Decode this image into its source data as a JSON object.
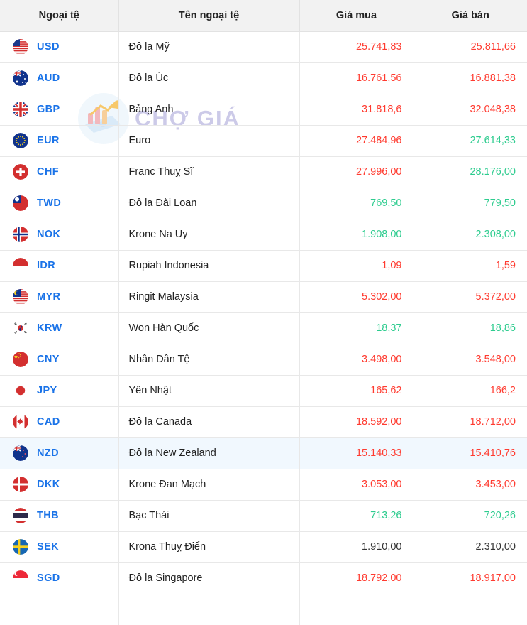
{
  "watermark": {
    "text": "CHỢ GIÁ",
    "logo_icon": "chart-wallet-logo-icon",
    "color": "#b9b6e0"
  },
  "colors": {
    "header_bg": "#f2f2f2",
    "code_blue": "#1a73e8",
    "up_red": "#ff3b30",
    "down_green": "#2ecc8f",
    "flat_black": "#333333",
    "highlight_row_bg": "#f1f8fe"
  },
  "table": {
    "columns": [
      {
        "key": "code",
        "label": "Ngoại tệ",
        "align": "center"
      },
      {
        "key": "name",
        "label": "Tên ngoại tệ",
        "align": "center"
      },
      {
        "key": "buy",
        "label": "Giá mua",
        "align": "center"
      },
      {
        "key": "sell",
        "label": "Giá bán",
        "align": "center"
      }
    ],
    "rows": [
      {
        "code": "USD",
        "flag": "flag-us",
        "name": "Đô la Mỹ",
        "buy": "25.741,83",
        "sell": "25.811,66",
        "buy_trend": "up",
        "sell_trend": "up",
        "highlight": false
      },
      {
        "code": "AUD",
        "flag": "flag-au",
        "name": "Đô la Úc",
        "buy": "16.761,56",
        "sell": "16.881,38",
        "buy_trend": "up",
        "sell_trend": "up",
        "highlight": false
      },
      {
        "code": "GBP",
        "flag": "flag-gb",
        "name": "Bảng Anh",
        "buy": "31.818,6",
        "sell": "32.048,38",
        "buy_trend": "up",
        "sell_trend": "up",
        "highlight": false
      },
      {
        "code": "EUR",
        "flag": "flag-eu",
        "name": "Euro",
        "buy": "27.484,96",
        "sell": "27.614,33",
        "buy_trend": "up",
        "sell_trend": "down",
        "highlight": false
      },
      {
        "code": "CHF",
        "flag": "flag-ch",
        "name": "Franc Thuỵ Sĩ",
        "buy": "27.996,00",
        "sell": "28.176,00",
        "buy_trend": "up",
        "sell_trend": "down",
        "highlight": false
      },
      {
        "code": "TWD",
        "flag": "flag-tw",
        "name": "Đô la Đài Loan",
        "buy": "769,50",
        "sell": "779,50",
        "buy_trend": "down",
        "sell_trend": "down",
        "highlight": false
      },
      {
        "code": "NOK",
        "flag": "flag-no",
        "name": "Krone Na Uy",
        "buy": "1.908,00",
        "sell": "2.308,00",
        "buy_trend": "down",
        "sell_trend": "down",
        "highlight": false
      },
      {
        "code": "IDR",
        "flag": "flag-id",
        "name": "Rupiah Indonesia",
        "buy": "1,09",
        "sell": "1,59",
        "buy_trend": "up",
        "sell_trend": "up",
        "highlight": false
      },
      {
        "code": "MYR",
        "flag": "flag-my",
        "name": "Ringit Malaysia",
        "buy": "5.302,00",
        "sell": "5.372,00",
        "buy_trend": "up",
        "sell_trend": "up",
        "highlight": false
      },
      {
        "code": "KRW",
        "flag": "flag-kr",
        "name": "Won Hàn Quốc",
        "buy": "18,37",
        "sell": "18,86",
        "buy_trend": "down",
        "sell_trend": "down",
        "highlight": false
      },
      {
        "code": "CNY",
        "flag": "flag-cn",
        "name": "Nhân Dân Tệ",
        "buy": "3.498,00",
        "sell": "3.548,00",
        "buy_trend": "up",
        "sell_trend": "up",
        "highlight": false
      },
      {
        "code": "JPY",
        "flag": "flag-jp",
        "name": "Yên Nhật",
        "buy": "165,62",
        "sell": "166,2",
        "buy_trend": "up",
        "sell_trend": "up",
        "highlight": false
      },
      {
        "code": "CAD",
        "flag": "flag-ca",
        "name": "Đô la Canada",
        "buy": "18.592,00",
        "sell": "18.712,00",
        "buy_trend": "up",
        "sell_trend": "up",
        "highlight": false
      },
      {
        "code": "NZD",
        "flag": "flag-nz",
        "name": "Đô la New Zealand",
        "buy": "15.140,33",
        "sell": "15.410,76",
        "buy_trend": "up",
        "sell_trend": "up",
        "highlight": true
      },
      {
        "code": "DKK",
        "flag": "flag-dk",
        "name": "Krone Đan Mạch",
        "buy": "3.053,00",
        "sell": "3.453,00",
        "buy_trend": "up",
        "sell_trend": "up",
        "highlight": false
      },
      {
        "code": "THB",
        "flag": "flag-th",
        "name": "Bạc Thái",
        "buy": "713,26",
        "sell": "720,26",
        "buy_trend": "down",
        "sell_trend": "down",
        "highlight": false
      },
      {
        "code": "SEK",
        "flag": "flag-se",
        "name": "Krona Thuỵ Điển",
        "buy": "1.910,00",
        "sell": "2.310,00",
        "buy_trend": "flat",
        "sell_trend": "flat",
        "highlight": false
      },
      {
        "code": "SGD",
        "flag": "flag-sg",
        "name": "Đô la Singapore",
        "buy": "18.792,00",
        "sell": "18.917,00",
        "buy_trend": "up",
        "sell_trend": "up",
        "highlight": false
      }
    ]
  }
}
